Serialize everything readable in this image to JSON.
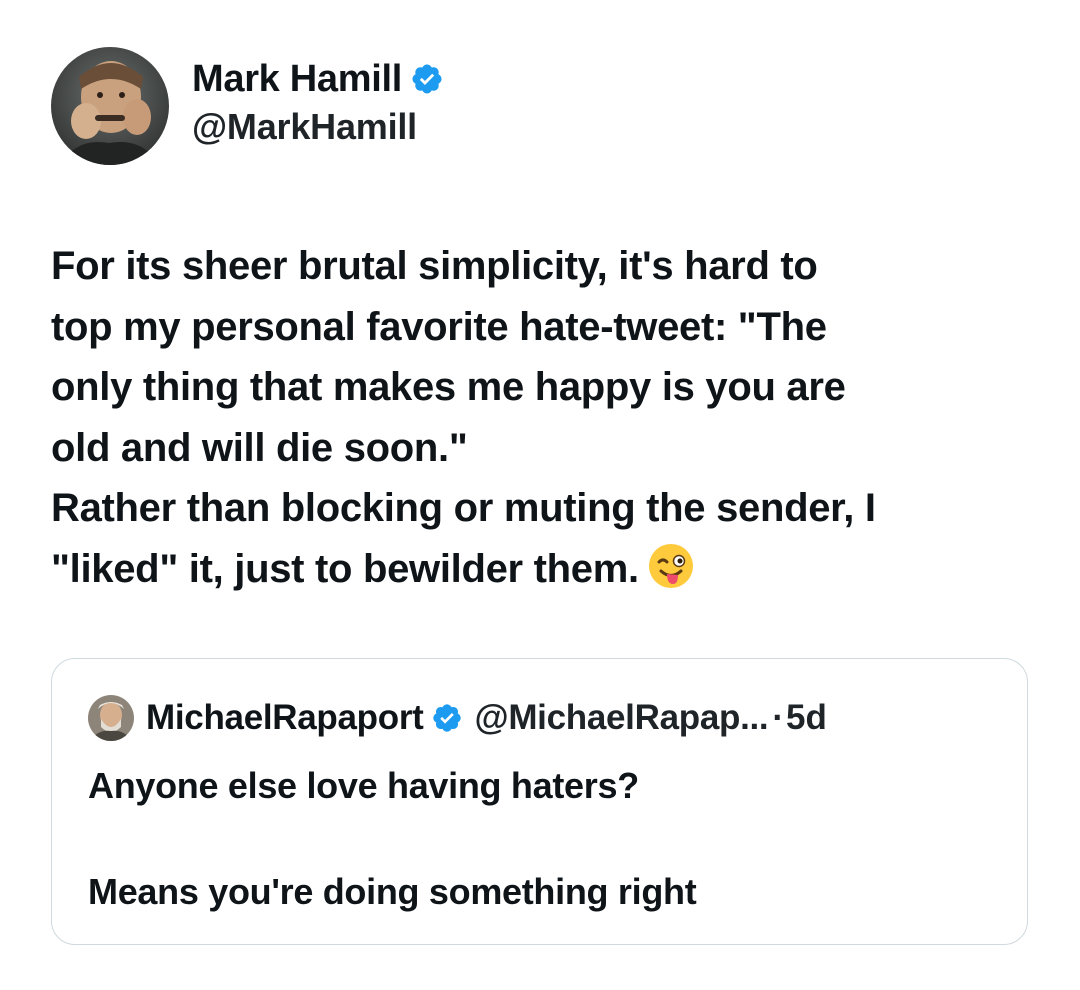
{
  "tweet": {
    "author": {
      "name": "Mark Hamill",
      "handle": "@MarkHamill",
      "verified": true,
      "verified_icon": "verified-badge-icon",
      "avatar_icon": "avatar-photo"
    },
    "text_lines": [
      "For its sheer brutal simplicity, it's hard to\ntop my personal favorite hate-tweet: \"The\nonly thing that makes me happy is you are\nold and will die soon.\"",
      "Rather than blocking or muting the sender, I\n\"liked\" it, just to bewilder them."
    ],
    "emoji": "winking-face-with-tongue-icon"
  },
  "quoted_tweet": {
    "author": {
      "name": "MichaelRapaport",
      "handle": "@MichaelRapap...",
      "verified": true,
      "avatar_icon": "avatar-photo"
    },
    "separator": "·",
    "time": "5d",
    "text_lines": [
      "Anyone else love having haters?",
      "Means you're doing something right"
    ]
  },
  "colors": {
    "text": "#0f1419",
    "verified_badge": "#1d9bf0",
    "card_border": "#cfd9de"
  }
}
